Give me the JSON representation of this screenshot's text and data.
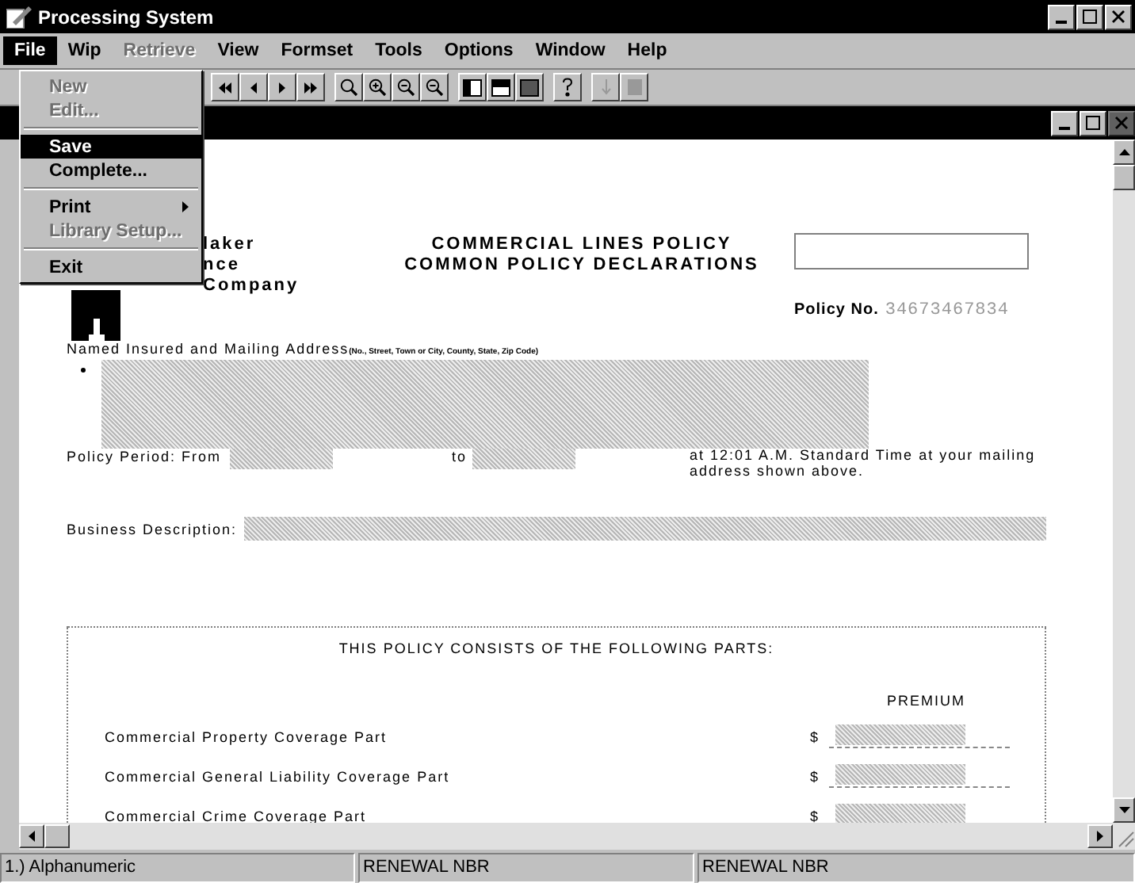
{
  "window": {
    "title": "Processing System"
  },
  "menu_bar": [
    {
      "label": "File",
      "selected": true,
      "disabled": false
    },
    {
      "label": "Wip",
      "selected": false,
      "disabled": false
    },
    {
      "label": "Retrieve",
      "selected": false,
      "disabled": true
    },
    {
      "label": "View",
      "selected": false,
      "disabled": false
    },
    {
      "label": "Formset",
      "selected": false,
      "disabled": false
    },
    {
      "label": "Tools",
      "selected": false,
      "disabled": false
    },
    {
      "label": "Options",
      "selected": false,
      "disabled": false
    },
    {
      "label": "Window",
      "selected": false,
      "disabled": false
    },
    {
      "label": "Help",
      "selected": false,
      "disabled": false
    }
  ],
  "file_menu": [
    {
      "kind": "item",
      "label": "New",
      "disabled": true,
      "selected": false,
      "submenu": false
    },
    {
      "kind": "item",
      "label": "Edit...",
      "disabled": true,
      "selected": false,
      "submenu": false
    },
    {
      "kind": "separator"
    },
    {
      "kind": "item",
      "label": "Save",
      "disabled": false,
      "selected": true,
      "submenu": false
    },
    {
      "kind": "item",
      "label": "Complete...",
      "disabled": false,
      "selected": false,
      "submenu": false
    },
    {
      "kind": "separator"
    },
    {
      "kind": "item",
      "label": "Print",
      "disabled": false,
      "selected": false,
      "submenu": true
    },
    {
      "kind": "item",
      "label": "Library Setup...",
      "disabled": true,
      "selected": false,
      "submenu": false
    },
    {
      "kind": "separator"
    },
    {
      "kind": "item",
      "label": "Exit",
      "disabled": false,
      "selected": false,
      "submenu": false
    }
  ],
  "document": {
    "company_name": [
      "laker",
      "nce",
      "Company"
    ],
    "title": [
      "COMMERCIAL LINES POLICY",
      "COMMON POLICY DECLARATIONS"
    ],
    "policy_no_label": "Policy No.",
    "policy_no": "34673467834",
    "named_insured_label": "Named Insured and Mailing Address",
    "named_insured_hint": "(No., Street, Town or City, County, State, Zip Code)",
    "period_label": "Policy Period: From",
    "period_to": "to",
    "period_note": "at 12:01 A.M. Standard Time at your mailing address shown above.",
    "business_label": "Business Description:",
    "parts_heading": "THIS POLICY CONSISTS OF THE FOLLOWING PARTS:",
    "premium_heading": "PREMIUM",
    "parts": [
      {
        "name": "Commercial Property Coverage Part",
        "currency": "$"
      },
      {
        "name": "Commercial General Liability Coverage Part",
        "currency": "$"
      },
      {
        "name": "Commercial Crime Coverage Part",
        "currency": "$"
      }
    ]
  },
  "status_bar": [
    "1.) Alphanumeric",
    "RENEWAL NBR",
    "RENEWAL NBR"
  ]
}
